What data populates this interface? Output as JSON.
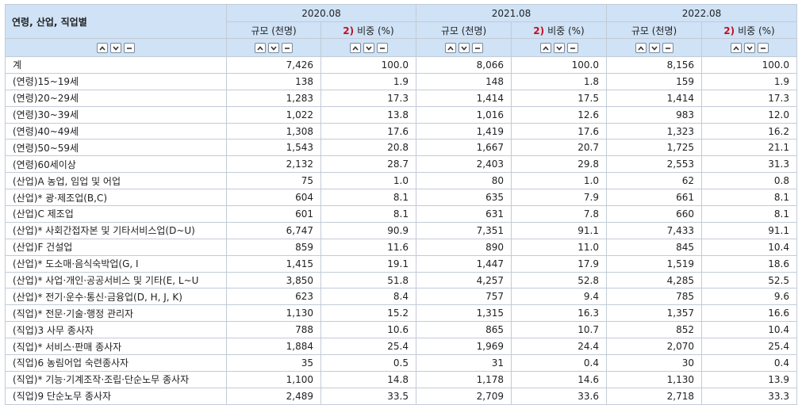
{
  "corner_header": "연령, 산업, 직업별",
  "periods": [
    "2020.08",
    "2021.08",
    "2022.08"
  ],
  "sub_headers": {
    "scale": "규모 (천명)",
    "ratio_note": "2)",
    "ratio": "비중 (%)"
  },
  "sort_controls": {
    "up_icon": "chevron-up-icon",
    "down_icon": "chevron-down-icon",
    "reset_icon": "minus-icon"
  },
  "rows": [
    {
      "label": "계",
      "v": [
        "7,426",
        "100.0",
        "8,066",
        "100.0",
        "8,156",
        "100.0"
      ]
    },
    {
      "label": "(연령)15~19세",
      "v": [
        "138",
        "1.9",
        "148",
        "1.8",
        "159",
        "1.9"
      ]
    },
    {
      "label": "(연령)20~29세",
      "v": [
        "1,283",
        "17.3",
        "1,414",
        "17.5",
        "1,414",
        "17.3"
      ]
    },
    {
      "label": "(연령)30~39세",
      "v": [
        "1,022",
        "13.8",
        "1,016",
        "12.6",
        "983",
        "12.0"
      ]
    },
    {
      "label": "(연령)40~49세",
      "v": [
        "1,308",
        "17.6",
        "1,419",
        "17.6",
        "1,323",
        "16.2"
      ]
    },
    {
      "label": "(연령)50~59세",
      "v": [
        "1,543",
        "20.8",
        "1,667",
        "20.7",
        "1,725",
        "21.1"
      ]
    },
    {
      "label": "(연령)60세이상",
      "v": [
        "2,132",
        "28.7",
        "2,403",
        "29.8",
        "2,553",
        "31.3"
      ]
    },
    {
      "label": "(산업)A 농업, 임업 및 어업",
      "v": [
        "75",
        "1.0",
        "80",
        "1.0",
        "62",
        "0.8"
      ]
    },
    {
      "label": "(산업)* 광·제조업(B,C)",
      "v": [
        "604",
        "8.1",
        "635",
        "7.9",
        "661",
        "8.1"
      ]
    },
    {
      "label": "(산업)C 제조업",
      "v": [
        "601",
        "8.1",
        "631",
        "7.8",
        "660",
        "8.1"
      ]
    },
    {
      "label": "(산업)* 사회간접자본 및 기타서비스업(D~U)",
      "v": [
        "6,747",
        "90.9",
        "7,351",
        "91.1",
        "7,433",
        "91.1"
      ]
    },
    {
      "label": "(산업)F 건설업",
      "v": [
        "859",
        "11.6",
        "890",
        "11.0",
        "845",
        "10.4"
      ]
    },
    {
      "label": "(산업)* 도소매·음식숙박업(G, I",
      "v": [
        "1,415",
        "19.1",
        "1,447",
        "17.9",
        "1,519",
        "18.6"
      ]
    },
    {
      "label": "(산업)* 사업·개인·공공서비스 및 기타(E, L~U",
      "v": [
        "3,850",
        "51.8",
        "4,257",
        "52.8",
        "4,285",
        "52.5"
      ]
    },
    {
      "label": "(산업)* 전기·운수·통신·금융업(D, H, J, K)",
      "v": [
        "623",
        "8.4",
        "757",
        "9.4",
        "785",
        "9.6"
      ]
    },
    {
      "label": "(직업)* 전문·기술·행정 관리자",
      "v": [
        "1,130",
        "15.2",
        "1,315",
        "16.3",
        "1,357",
        "16.6"
      ]
    },
    {
      "label": "(직업)3 사무 종사자",
      "v": [
        "788",
        "10.6",
        "865",
        "10.7",
        "852",
        "10.4"
      ]
    },
    {
      "label": "(직업)* 서비스·판매 종사자",
      "v": [
        "1,884",
        "25.4",
        "1,969",
        "24.4",
        "2,070",
        "25.4"
      ]
    },
    {
      "label": "(직업)6 농림어업 숙련종사자",
      "v": [
        "35",
        "0.5",
        "31",
        "0.4",
        "30",
        "0.4"
      ]
    },
    {
      "label": "(직업)* 기능·기계조작·조립·단순노무 종사자",
      "v": [
        "1,100",
        "14.8",
        "1,178",
        "14.6",
        "1,130",
        "13.9"
      ]
    },
    {
      "label": "(직업)9 단순노무 종사자",
      "v": [
        "2,489",
        "33.5",
        "2,709",
        "33.6",
        "2,718",
        "33.3"
      ]
    }
  ]
}
